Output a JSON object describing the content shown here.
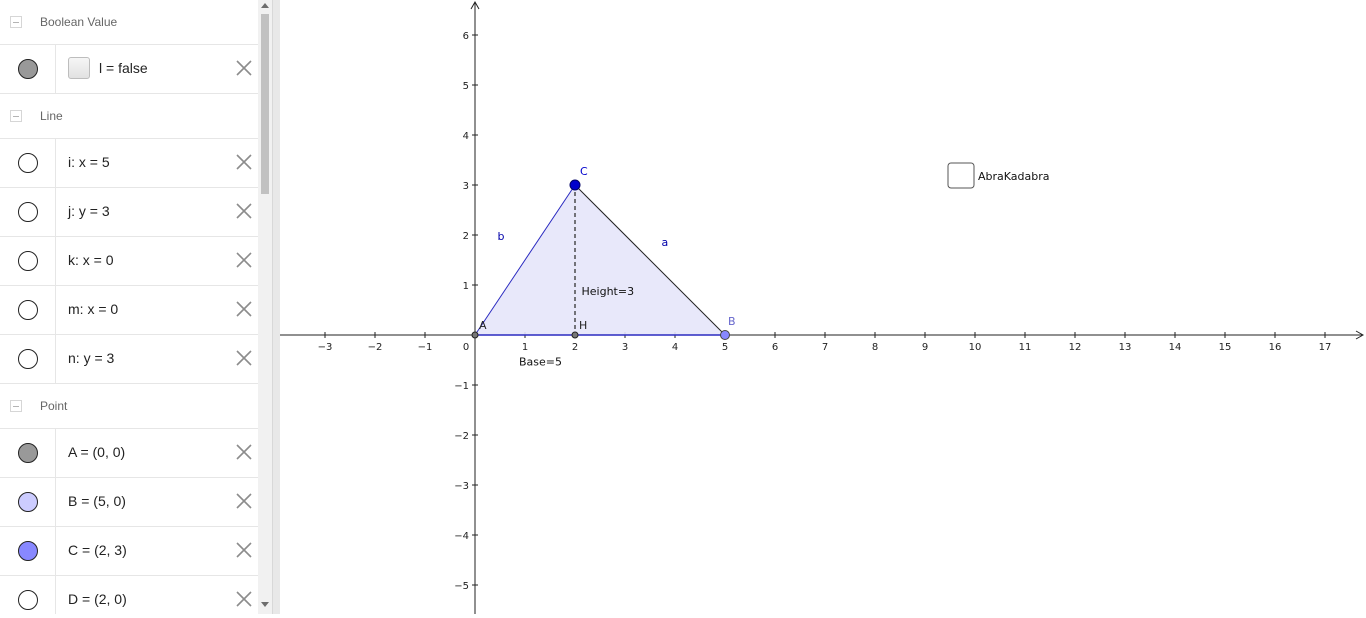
{
  "algebra": {
    "groups": [
      {
        "title": "Boolean Value",
        "items": [
          {
            "text": "l = false",
            "fill": "#999999",
            "has_checkbox": true
          }
        ]
      },
      {
        "title": "Line",
        "items": [
          {
            "text": "i: x = 5",
            "fill": "#ffffff"
          },
          {
            "text": "j: y = 3",
            "fill": "#ffffff"
          },
          {
            "text": "k: x = 0",
            "fill": "#ffffff"
          },
          {
            "text": "m: x = 0",
            "fill": "#ffffff"
          },
          {
            "text": "n: y = 3",
            "fill": "#ffffff"
          }
        ]
      },
      {
        "title": "Point",
        "items": [
          {
            "text": "A = (0, 0)",
            "fill": "#999999"
          },
          {
            "text": "B = (5, 0)",
            "fill": "#ccccff"
          },
          {
            "text": "C = (2, 3)",
            "fill": "#8888ff"
          },
          {
            "text": "D = (2, 0)",
            "fill": "#ffffff"
          }
        ]
      }
    ]
  },
  "graphics": {
    "x_ticks": [
      "−3",
      "−2",
      "−1",
      "0",
      "1",
      "2",
      "3",
      "4",
      "5",
      "6",
      "7",
      "8",
      "9",
      "10",
      "11",
      "12",
      "13",
      "14",
      "15",
      "16",
      "17"
    ],
    "y_ticks_pos": [
      "1",
      "2",
      "3",
      "4",
      "5",
      "6"
    ],
    "y_ticks_neg": [
      "−1",
      "−2",
      "−3",
      "−4",
      "−5"
    ],
    "points": {
      "A": [
        0,
        0
      ],
      "B": [
        5,
        0
      ],
      "C": [
        2,
        3
      ],
      "H": [
        2,
        0
      ]
    },
    "point_labels": {
      "A": "A",
      "B": "B",
      "C": "C",
      "H": "H"
    },
    "segment_labels": {
      "a": "a",
      "b": "b"
    },
    "height_label": "Height=3",
    "base_label": "Base=5",
    "checkbox_label": "AbraKadabra",
    "colors": {
      "fill": "#e6e6fa",
      "edge": "#1a1aa0",
      "point_C": "#0000cc",
      "point_B": "#8888ff"
    }
  }
}
